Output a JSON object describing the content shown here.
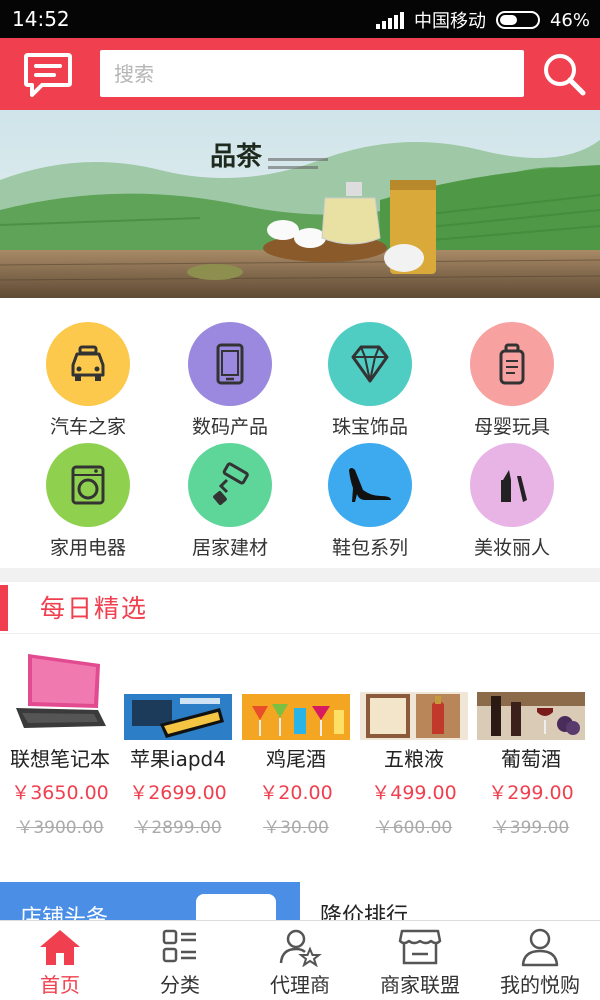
{
  "status_bar": {
    "time": "14:52",
    "carrier": "中国移动",
    "battery": "46%",
    "battery_level": 0.46
  },
  "header": {
    "search_placeholder": "搜索",
    "message_icon": "message-icon",
    "search_icon": "search-icon"
  },
  "banner": {
    "brand_text": "品茶"
  },
  "categories": [
    {
      "label": "汽车之家",
      "icon": "car-icon",
      "color": "#fcc94d"
    },
    {
      "label": "数码产品",
      "icon": "phone-icon",
      "color": "#9b88df"
    },
    {
      "label": "珠宝饰品",
      "icon": "diamond-icon",
      "color": "#4fcdc3"
    },
    {
      "label": "母婴玩具",
      "icon": "baby-bottle-icon",
      "color": "#f8a1a1"
    },
    {
      "label": "家用电器",
      "icon": "washing-machine-icon",
      "color": "#8fd14f"
    },
    {
      "label": "居家建材",
      "icon": "paint-roller-icon",
      "color": "#5ed69a"
    },
    {
      "label": "鞋包系列",
      "icon": "high-heel-icon",
      "color": "#3daaf0"
    },
    {
      "label": "美妆丽人",
      "icon": "lipstick-icon",
      "color": "#e7b4e5"
    }
  ],
  "daily": {
    "title": "每日精选",
    "products": [
      {
        "name": "联想笔记本",
        "price": "￥3650.00",
        "old_price": "￥3900.00"
      },
      {
        "name": "苹果iapd4",
        "price": "￥2699.00",
        "old_price": "￥2899.00"
      },
      {
        "name": "鸡尾酒",
        "price": "￥20.00",
        "old_price": "￥30.00"
      },
      {
        "name": "五粮液",
        "price": "￥499.00",
        "old_price": "￥600.00"
      },
      {
        "name": "葡萄酒",
        "price": "￥299.00",
        "old_price": "￥399.00"
      }
    ]
  },
  "promos": {
    "left": "店铺头条",
    "right": "降价排行"
  },
  "tabs": [
    {
      "label": "首页",
      "icon": "home-icon",
      "active": true
    },
    {
      "label": "分类",
      "icon": "category-icon",
      "active": false
    },
    {
      "label": "代理商",
      "icon": "agent-icon",
      "active": false
    },
    {
      "label": "商家联盟",
      "icon": "store-icon",
      "active": false
    },
    {
      "label": "我的悦购",
      "icon": "user-icon",
      "active": false
    }
  ],
  "colors": {
    "brand": "#f0404f",
    "status_bg": "#050505"
  }
}
